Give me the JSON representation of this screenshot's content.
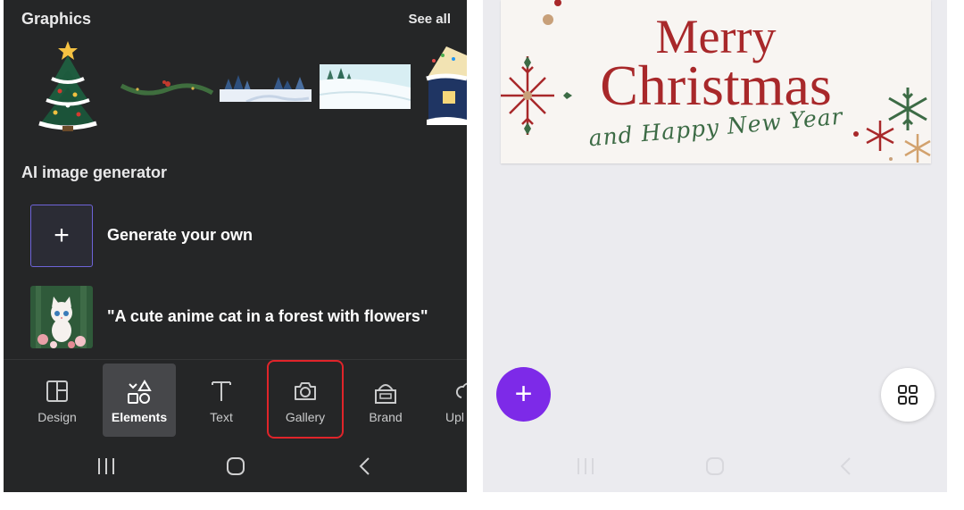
{
  "left": {
    "graphics": {
      "title": "Graphics",
      "see_all": "See all",
      "items": [
        "christmas-tree",
        "garland",
        "winter-landscape",
        "snowy-field",
        "gingerbread-house"
      ]
    },
    "ai": {
      "title": "AI image generator",
      "generate_label": "Generate your own",
      "generate_icon": "+",
      "prompt_label": "\"A cute anime cat in a forest with flowers\""
    },
    "tabs": [
      {
        "label": "Design",
        "icon": "layout-icon"
      },
      {
        "label": "Elements",
        "icon": "shapes-icon"
      },
      {
        "label": "Text",
        "icon": "text-icon"
      },
      {
        "label": "Gallery",
        "icon": "camera-icon"
      },
      {
        "label": "Brand",
        "icon": "brand-icon"
      },
      {
        "label": "Upl",
        "icon": "cloud-icon"
      }
    ],
    "active_tab": "Elements",
    "highlighted_tab": "Gallery"
  },
  "right": {
    "card": {
      "line1": "Merry",
      "line2": "Christmas",
      "line3": "and Happy New Year"
    },
    "fab_add": "+",
    "colors": {
      "accent": "#7d2ae8",
      "card_red": "#a8282a",
      "card_green": "#3c6b45"
    }
  }
}
